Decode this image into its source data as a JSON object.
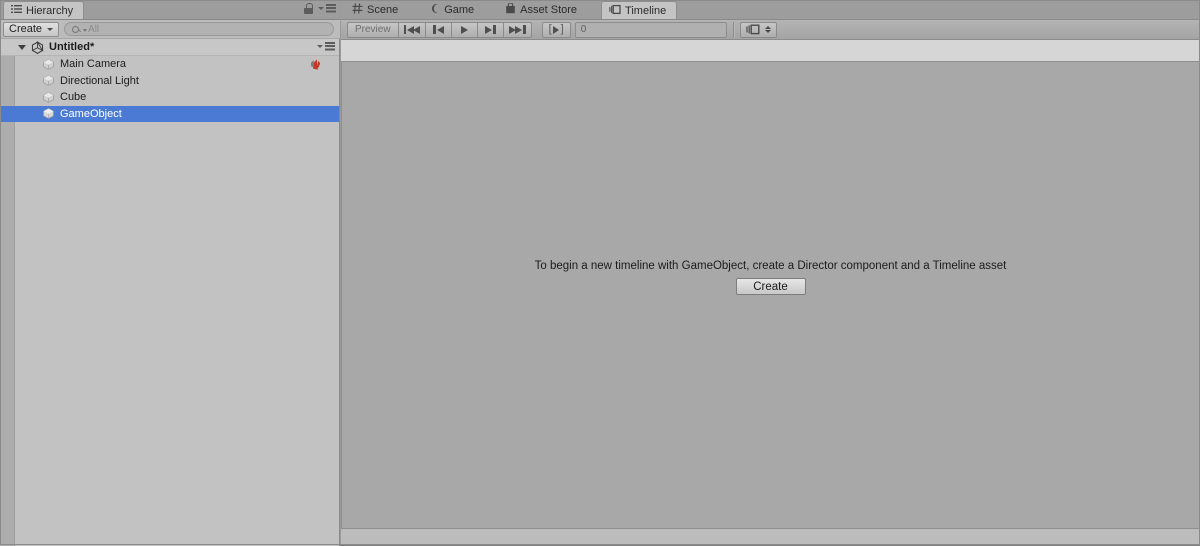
{
  "hierarchy": {
    "tab": {
      "label": "Hierarchy",
      "icon": "list-icon"
    },
    "header_icons": {
      "lock": "lock-icon",
      "menu": "options-menu-icon"
    },
    "toolbar": {
      "create_label": "Create",
      "search_placeholder": "All",
      "search_value": ""
    },
    "scene": {
      "name": "Untitled*",
      "icon": "unity-scene-icon",
      "expanded": true
    },
    "objects": [
      {
        "name": "Main Camera",
        "icon": "gameobject-icon",
        "selected": false,
        "right_icon": "audio-listener-icon"
      },
      {
        "name": "Directional Light",
        "icon": "gameobject-icon",
        "selected": false,
        "right_icon": null
      },
      {
        "name": "Cube",
        "icon": "gameobject-icon",
        "selected": false,
        "right_icon": null
      },
      {
        "name": "GameObject",
        "icon": "gameobject-icon",
        "selected": true,
        "right_icon": null
      }
    ]
  },
  "timeline": {
    "tabs": [
      {
        "label": "Scene",
        "icon": "grid-icon",
        "active": false
      },
      {
        "label": "Game",
        "icon": "game-icon",
        "active": false
      },
      {
        "label": "Asset Store",
        "icon": "store-icon",
        "active": false
      },
      {
        "label": "Timeline",
        "icon": "timeline-icon",
        "active": true
      }
    ],
    "toolbar": {
      "preview_label": "Preview",
      "go_to_start_icon": "skip-to-start-icon",
      "previous_frame_icon": "step-back-icon",
      "play_icon": "play-icon",
      "next_frame_icon": "step-forward-icon",
      "go_to_end_icon": "skip-to-end-icon",
      "play_range_icon": "play-range-icon",
      "frame_value": "0",
      "frame_placeholder": "0",
      "frame_rate_icon": "frame-icon"
    },
    "empty_state": {
      "message": "To begin a new timeline with GameObject, create a Director component and a Timeline asset",
      "create_label": "Create"
    }
  },
  "colors": {
    "selection_blue": "#4a7ad4",
    "panel_bg": "#c2c2c2",
    "content_bg": "#a8a8a8",
    "tabstrip_bg": "#9d9d9d",
    "toolbar_bg": "#b4b4b4"
  }
}
